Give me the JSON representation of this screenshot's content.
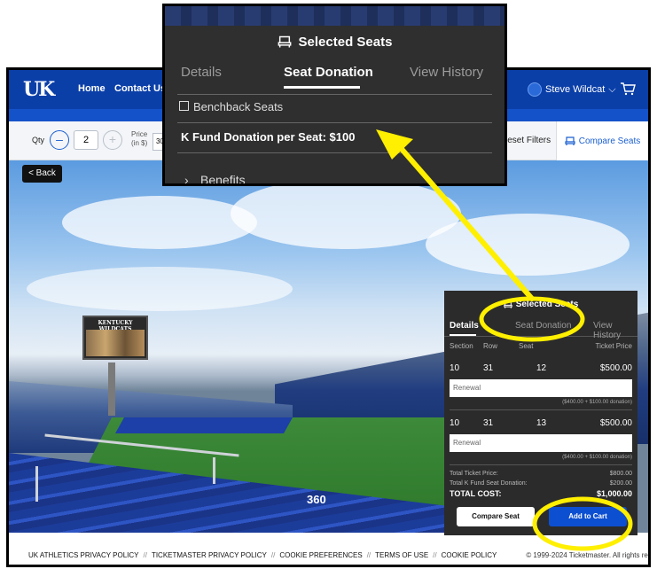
{
  "nav": {
    "logo": "UK",
    "home": "Home",
    "contact": "Contact Us",
    "user": "Steve Wildcat",
    "user_chevron": "⌵"
  },
  "filters": {
    "qty_label": "Qty",
    "qty_value": "2",
    "price_label": "Price\n(in $)",
    "price_value": "300",
    "reset": "Reset Filters",
    "compare": "Compare Seats"
  },
  "view": {
    "back": "< Back",
    "label_360": "360",
    "scoreboard": "KENTUCKY WILDCATS"
  },
  "panel": {
    "title": "Selected Seats",
    "tabs": [
      "Details",
      "Seat Donation",
      "View History"
    ],
    "headers": [
      "Section",
      "Row",
      "Seat",
      "Ticket Price"
    ],
    "seats": [
      {
        "section": "10",
        "row": "31",
        "seat": "12",
        "price": "$500.00",
        "status": "Renewal",
        "note": "($400.00 + $100.00 donation)"
      },
      {
        "section": "10",
        "row": "31",
        "seat": "13",
        "price": "$500.00",
        "status": "Renewal",
        "note": "($400.00 + $100.00 donation)"
      }
    ],
    "total_ticket_label": "Total Ticket Price:",
    "total_ticket_value": "$800.00",
    "total_kfund_label": "Total K Fund Seat Donation:",
    "total_kfund_value": "$200.00",
    "total_cost_label": "TOTAL COST:",
    "total_cost_value": "$1,000.00",
    "compare_button": "Compare Seat",
    "add_cart_button": "Add to Cart"
  },
  "footer": {
    "links": [
      "UK ATHLETICS PRIVACY POLICY",
      "TICKETMASTER PRIVACY POLICY",
      "COOKIE PREFERENCES",
      "TERMS OF USE",
      "COOKIE POLICY"
    ],
    "separator": "//",
    "copyright": "© 1999-2024 Ticketmaster. All rights reserved."
  },
  "callout": {
    "title": "Selected Seats",
    "tabs": [
      "Details",
      "Seat Donation",
      "View History"
    ],
    "benchback": "Benchback Seats",
    "kfund": "K Fund Donation per Seat: $100",
    "benefits": "Benefits"
  },
  "colors": {
    "brand_blue": "#0b3fa8",
    "panel_dark": "#2b2b2b",
    "annotation_yellow": "#ffef00",
    "cta_blue": "#0d4fd1"
  }
}
